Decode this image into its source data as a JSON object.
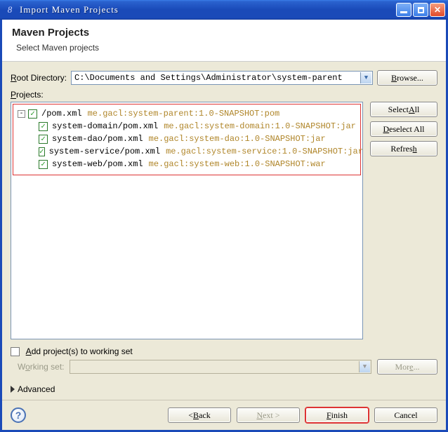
{
  "titlebar": {
    "title": "Import Maven Projects",
    "app_icon": "8"
  },
  "header": {
    "title": "Maven Projects",
    "subtitle": "Select Maven projects"
  },
  "root_dir": {
    "label_pre": "",
    "label_mn": "R",
    "label_post": "oot Directory:",
    "value": "C:\\Documents and Settings\\Administrator\\system-parent",
    "browse_mn": "B",
    "browse_post": "rowse..."
  },
  "projects_label": {
    "mn": "P",
    "post": "rojects:"
  },
  "tree": [
    {
      "indent": 0,
      "expander": "-",
      "path": "/pom.xml",
      "gav": "me.gacl:system-parent:1.0-SNAPSHOT:pom"
    },
    {
      "indent": 1,
      "path": "system-domain/pom.xml",
      "gav": "me.gacl:system-domain:1.0-SNAPSHOT:jar"
    },
    {
      "indent": 1,
      "path": "system-dao/pom.xml",
      "gav": "me.gacl:system-dao:1.0-SNAPSHOT:jar"
    },
    {
      "indent": 1,
      "path": "system-service/pom.xml",
      "gav": "me.gacl:system-service:1.0-SNAPSHOT:jar"
    },
    {
      "indent": 1,
      "path": "system-web/pom.xml",
      "gav": "me.gacl:system-web:1.0-SNAPSHOT:war"
    }
  ],
  "side": {
    "select_all_pre": "Select ",
    "select_all_mn": "A",
    "select_all_post": "ll",
    "deselect_mn": "D",
    "deselect_post": "eselect All",
    "refresh_pre": "Refres",
    "refresh_mn": "h",
    "refresh_post": ""
  },
  "workset": {
    "checkbox_mn": "A",
    "checkbox_post": "dd project(s) to working set",
    "label_pre": "W",
    "label_mn": "o",
    "label_post": "rking set:",
    "more_pre": "Mor",
    "more_mn": "e",
    "more_post": "..."
  },
  "advanced": "Advanced",
  "footer": {
    "back": "< Back",
    "next": "Next >",
    "finish": "Finish",
    "cancel": "Cancel",
    "back_mn": "B",
    "next_mn": "N",
    "finish_mn": "F"
  }
}
